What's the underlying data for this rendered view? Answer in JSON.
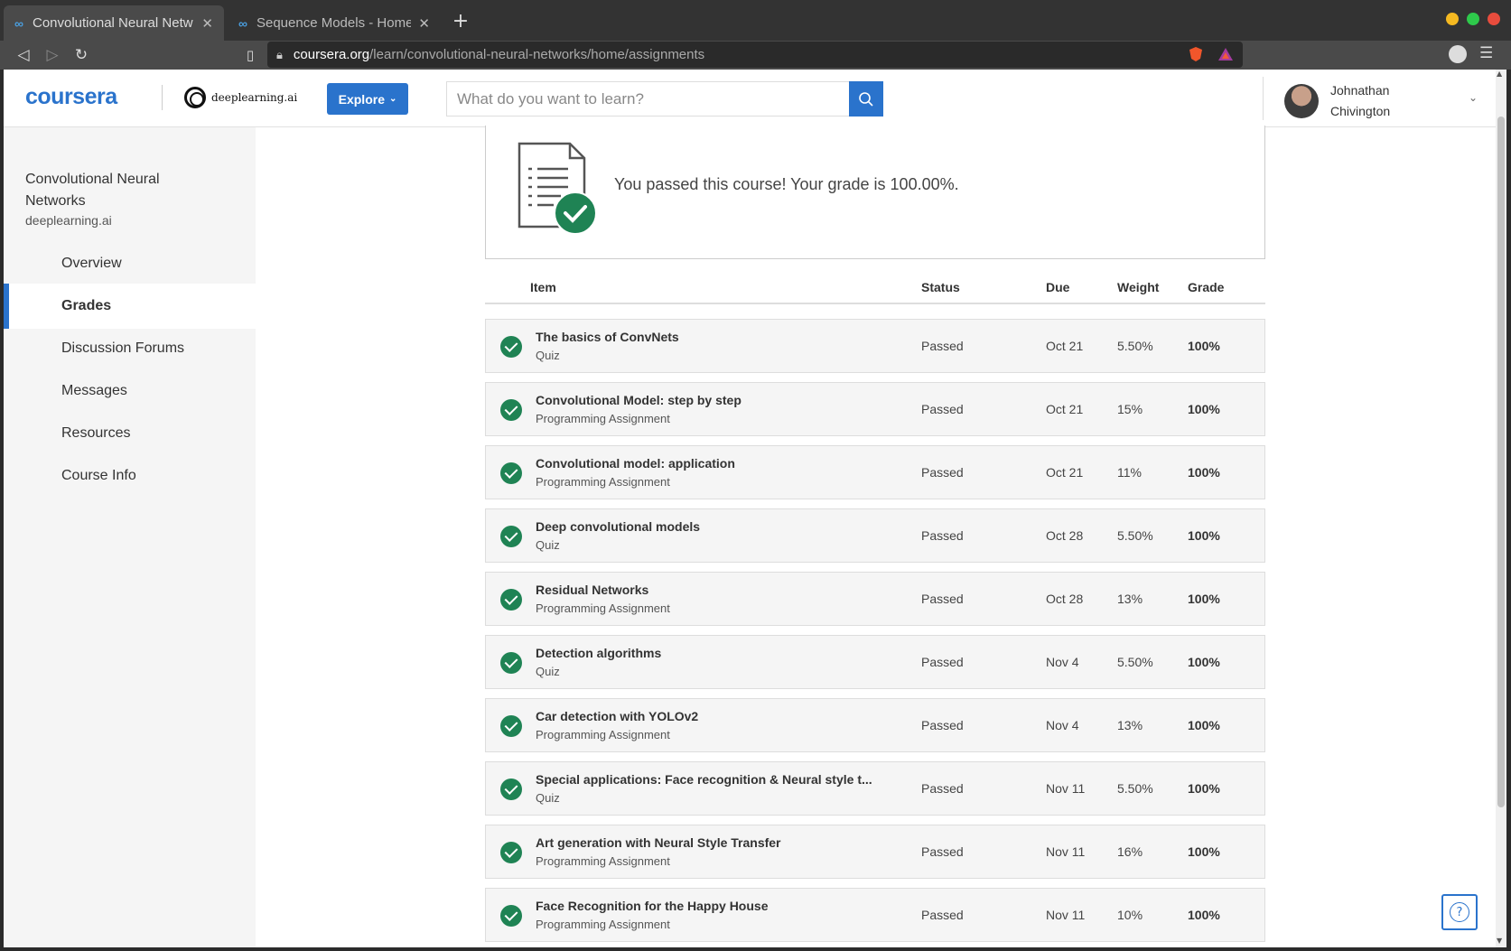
{
  "browser": {
    "tabs": [
      {
        "title": "Convolutional Neural Netw",
        "active": true
      },
      {
        "title": "Sequence Models - Home |",
        "active": false
      }
    ],
    "url_host": "coursera.org",
    "url_path": "/learn/convolutional-neural-networks/home/assignments"
  },
  "header": {
    "logo": "coursera",
    "partner_logo": "deeplearning.ai",
    "explore_label": "Explore",
    "search_placeholder": "What do you want to learn?",
    "user_first": "Johnathan",
    "user_last": "Chivington"
  },
  "sidebar": {
    "course_title": "Convolutional Neural Networks",
    "course_org": "deeplearning.ai",
    "items": [
      {
        "label": "Overview",
        "active": false
      },
      {
        "label": "Grades",
        "active": true
      },
      {
        "label": "Discussion Forums",
        "active": false
      },
      {
        "label": "Messages",
        "active": false
      },
      {
        "label": "Resources",
        "active": false
      },
      {
        "label": "Course Info",
        "active": false
      }
    ]
  },
  "main": {
    "pass_message": "You passed this course! Your grade is 100.00%.",
    "columns": {
      "item": "Item",
      "status": "Status",
      "due": "Due",
      "weight": "Weight",
      "grade": "Grade"
    },
    "rows": [
      {
        "name": "The basics of ConvNets",
        "type": "Quiz",
        "status": "Passed",
        "due": "Oct 21",
        "weight": "5.50%",
        "grade": "100%"
      },
      {
        "name": "Convolutional Model: step by step",
        "type": "Programming Assignment",
        "status": "Passed",
        "due": "Oct 21",
        "weight": "15%",
        "grade": "100%"
      },
      {
        "name": "Convolutional model: application",
        "type": "Programming Assignment",
        "status": "Passed",
        "due": "Oct 21",
        "weight": "11%",
        "grade": "100%"
      },
      {
        "name": "Deep convolutional models",
        "type": "Quiz",
        "status": "Passed",
        "due": "Oct 28",
        "weight": "5.50%",
        "grade": "100%"
      },
      {
        "name": "Residual Networks",
        "type": "Programming Assignment",
        "status": "Passed",
        "due": "Oct 28",
        "weight": "13%",
        "grade": "100%"
      },
      {
        "name": "Detection algorithms",
        "type": "Quiz",
        "status": "Passed",
        "due": "Nov 4",
        "weight": "5.50%",
        "grade": "100%"
      },
      {
        "name": "Car detection with YOLOv2",
        "type": "Programming Assignment",
        "status": "Passed",
        "due": "Nov 4",
        "weight": "13%",
        "grade": "100%"
      },
      {
        "name": "Special applications: Face recognition & Neural style t...",
        "type": "Quiz",
        "status": "Passed",
        "due": "Nov 11",
        "weight": "5.50%",
        "grade": "100%"
      },
      {
        "name": "Art generation with Neural Style Transfer",
        "type": "Programming Assignment",
        "status": "Passed",
        "due": "Nov 11",
        "weight": "16%",
        "grade": "100%"
      },
      {
        "name": "Face Recognition for the Happy House",
        "type": "Programming Assignment",
        "status": "Passed",
        "due": "Nov 11",
        "weight": "10%",
        "grade": "100%"
      }
    ]
  },
  "colors": {
    "accent": "#2a73cc",
    "success": "#1f8354"
  }
}
